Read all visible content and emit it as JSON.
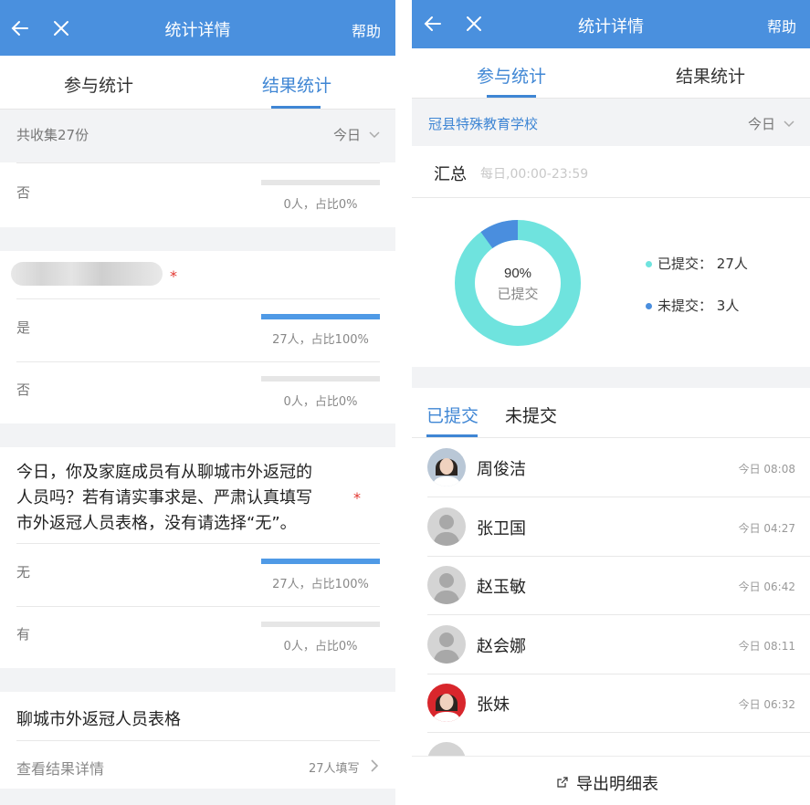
{
  "left": {
    "header": {
      "title": "统计详情",
      "help": "帮助"
    },
    "tabs": [
      {
        "label": "参与统计"
      },
      {
        "label": "结果统计"
      }
    ],
    "summary": {
      "collected": "共收集27份",
      "filter": "今日"
    },
    "q1_options": [
      {
        "label": "否",
        "count": 0,
        "caption": "0人，占比0%",
        "fill": 0
      }
    ],
    "q2": {
      "options": [
        {
          "label": "是",
          "caption": "27人，占比100%",
          "fill": 1.0
        },
        {
          "label": "否",
          "caption": "0人，占比0%",
          "fill": 0
        }
      ]
    },
    "q3": {
      "question_line1": "今日，你及家庭成员有从聊城市外返冠的",
      "question_line2": "人员吗？若有请实事求是、严肃认真填写",
      "question_line3": "市外返冠人员表格，没有请选择“无”。",
      "required_mark": "*",
      "options": [
        {
          "label": "无",
          "caption": "27人，占比100%",
          "fill": 1.0
        },
        {
          "label": "有",
          "caption": "0人，占比0%",
          "fill": 0
        }
      ]
    },
    "q4": {
      "title": "聊城市外返冠人员表格",
      "view_label": "查看结果详情",
      "count": "27人填写"
    }
  },
  "right": {
    "header": {
      "title": "统计详情",
      "help": "帮助"
    },
    "tabs": [
      {
        "label": "参与统计"
      },
      {
        "label": "结果统计"
      }
    ],
    "school": {
      "name": "冠县特殊教育学校",
      "filter": "今日"
    },
    "summary": {
      "title": "汇总",
      "timespan": "每日,00:00-23:59"
    },
    "donut": {
      "percent_text": "90%",
      "center_label": "已提交",
      "submitted_fraction": 0.9,
      "colors": {
        "submitted": "#6fe3de",
        "not_submitted": "#4a8ede"
      }
    },
    "legend": [
      {
        "label": "已提交：",
        "value": "27人"
      },
      {
        "label": "未提交：",
        "value": "3人"
      }
    ],
    "list_tabs": [
      {
        "label": "已提交"
      },
      {
        "label": "未提交"
      }
    ],
    "people": [
      {
        "name": "周俊洁",
        "time": "今日 08:08",
        "avatar": "photo-woman"
      },
      {
        "name": "张卫国",
        "time": "今日 04:27",
        "avatar": "default-user"
      },
      {
        "name": "赵玉敏",
        "time": "今日 06:42",
        "avatar": "default-user"
      },
      {
        "name": "赵会娜",
        "time": "今日 08:11",
        "avatar": "default-user"
      },
      {
        "name": "张妹",
        "time": "今日 06:32",
        "avatar": "photo-woman-red"
      }
    ],
    "export_label": "导出明细表"
  }
}
